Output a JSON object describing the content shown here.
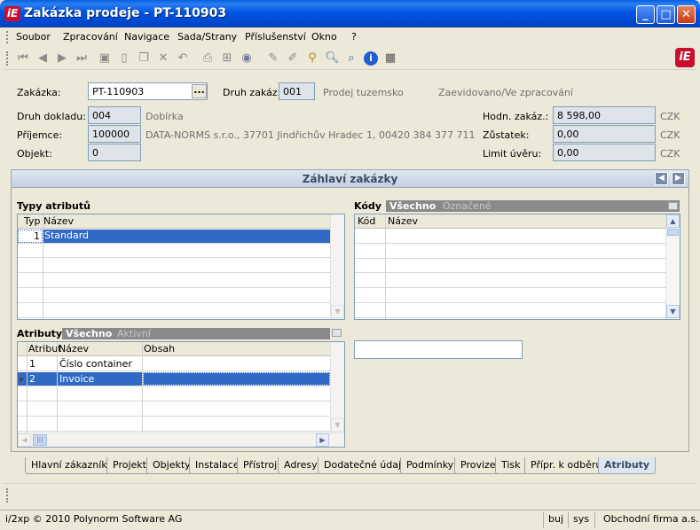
{
  "window": {
    "title": "Zakázka prodeje - PT-110903",
    "logo": "iE",
    "minimize": "_",
    "maximize": "□",
    "close": "✕"
  },
  "menu": [
    "Soubor",
    "Zpracování",
    "Navigace",
    "Sada/Strany",
    "Příslušenství",
    "Okno",
    "?"
  ],
  "toolbar_icons": [
    "first-icon",
    "prev-icon",
    "next-icon",
    "last-icon",
    "save-icon",
    "new-icon",
    "copy-icon",
    "delete-icon",
    "undo-icon",
    "print-icon",
    "tree-icon",
    "refresh-icon",
    "edit-icon",
    "edit2-icon",
    "find-icon",
    "search-icon",
    "zoom-icon",
    "info-icon",
    "calculator-icon"
  ],
  "header": {
    "zakazka_label": "Zakázka:",
    "zakazka_value": "PT-110903",
    "lookup": "...",
    "druh_zakaz_label": "Druh zakáz.:",
    "druh_zakaz_value": "001",
    "druh_zakaz_text": "Prodej tuzemsko",
    "state_text": "Zaevidovano/Ve zpracování",
    "druh_dokladu_label": "Druh dokladu:",
    "druh_dokladu_value": "004",
    "druh_dokladu_text": "Dobírka",
    "prijemce_label": "Příjemce:",
    "prijemce_value": "100000",
    "prijemce_text": "DATA-NORMS s.r.o., 37701 Jindřichův Hradec 1, 00420 384 377 711",
    "objekt_label": "Objekt:",
    "objekt_value": "0",
    "hodn_label": "Hodn. zakáz.:",
    "hodn_value": "8 598,00",
    "hodn_currency": "CZK",
    "zustatek_label": "Zůstatek:",
    "zustatek_value": "0,00",
    "zustatek_currency": "CZK",
    "limit_label": "Limit úvěru:",
    "limit_value": "0,00",
    "limit_currency": "CZK"
  },
  "section": {
    "title": "Záhlaví zakázky",
    "prev": "◀",
    "next": "▶"
  },
  "typy": {
    "title": "Typy atributů",
    "columns": [
      "Typ",
      "Název"
    ],
    "rows": [
      {
        "typ": "1",
        "nazev": "Standard"
      }
    ]
  },
  "kody": {
    "title": "Kódy",
    "seg_all": "Všechno",
    "seg_marked": "Označené",
    "columns": [
      "Kód",
      "Název"
    ]
  },
  "atributy": {
    "title": "Atributy",
    "seg_all": "Všechno",
    "seg_active": "Aktivní",
    "columns": [
      "Atribut",
      "Název",
      "Obsah"
    ],
    "rows": [
      {
        "atribut": "1",
        "nazev": "Číslo container",
        "obsah": ""
      },
      {
        "atribut": "2",
        "nazev": "Invoice",
        "obsah": ""
      }
    ],
    "hscroll_thumb": "|||"
  },
  "tabs": [
    "Hlavní zákazník",
    "Projekt",
    "Objekty",
    "Instalace",
    "Přístroj",
    "Adresy",
    "Dodatečné údaje",
    "Podmínky",
    "Provize",
    "Tisk",
    "Přípr. k odběru",
    "Atributy"
  ],
  "status": {
    "copyright": "i/2xp © 2010 Polynorm Software AG",
    "user": "buj",
    "db": "sys",
    "company": "Obchodní firma a.s."
  }
}
